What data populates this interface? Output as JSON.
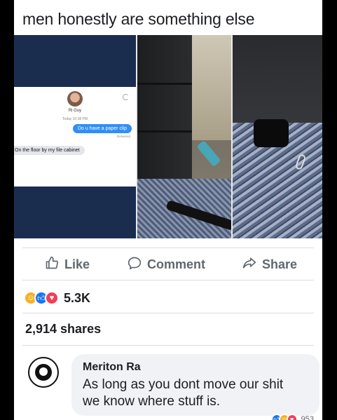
{
  "caption": "men honestly are something else",
  "chat": {
    "contact_name": "Ri Guy",
    "date": "Today 10:38 PM",
    "outgoing": "Do u have a paper clip",
    "status": "Delivered",
    "incoming": "On the floor by my file cabinet"
  },
  "actions": {
    "like_label": "Like",
    "comment_label": "Comment",
    "share_label": "Share"
  },
  "reactions": {
    "count": "5.3K",
    "icons": [
      "haha-icon",
      "like-icon",
      "love-icon"
    ]
  },
  "shares_text": "2,914 shares",
  "comment": {
    "author": "Meriton Ra",
    "text_line1": "As long as you dont move our shit",
    "text_line2": "we know where stuff is.",
    "reaction_count": "953"
  },
  "colors": {
    "fb_blue": "#1877f2",
    "text_primary": "#1c1e21",
    "text_secondary": "#606770",
    "bubble_bg": "#f0f2f5"
  }
}
